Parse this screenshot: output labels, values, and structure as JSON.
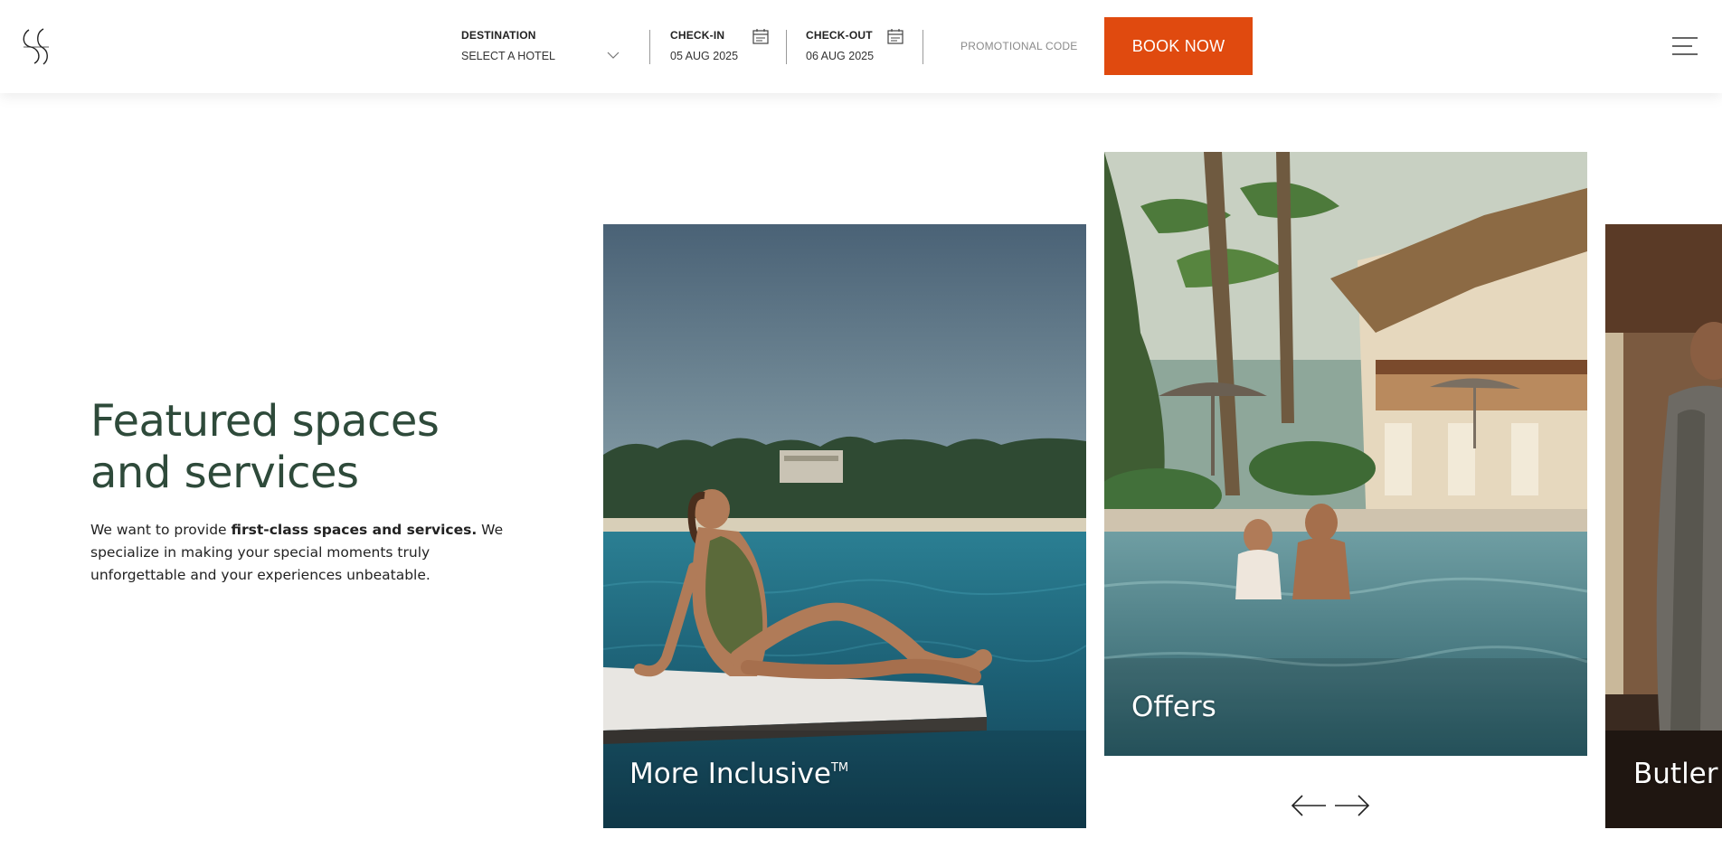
{
  "header": {
    "destination": {
      "label": "DESTINATION",
      "value": "SELECT A HOTEL"
    },
    "checkin": {
      "label": "CHECK-IN",
      "value": "05  AUG 2025"
    },
    "checkout": {
      "label": "CHECK-OUT",
      "value": "06  AUG 2025"
    },
    "promo_placeholder": "PROMOTIONAL CODE",
    "book_label": "BOOK NOW"
  },
  "intro": {
    "title": "Featured spaces and services",
    "desc_prefix": "We want to provide ",
    "desc_bold": "first-class spaces and services.",
    "desc_suffix": " We specialize in making your special moments truly unforgettable and your experiences unbeatable."
  },
  "cards": [
    {
      "label": "More Inclusive",
      "mark": "TM"
    },
    {
      "label": "Offers"
    },
    {
      "label": "Butler service"
    }
  ],
  "colors": {
    "accent": "#e04a0f",
    "title": "#2e4a3a"
  }
}
